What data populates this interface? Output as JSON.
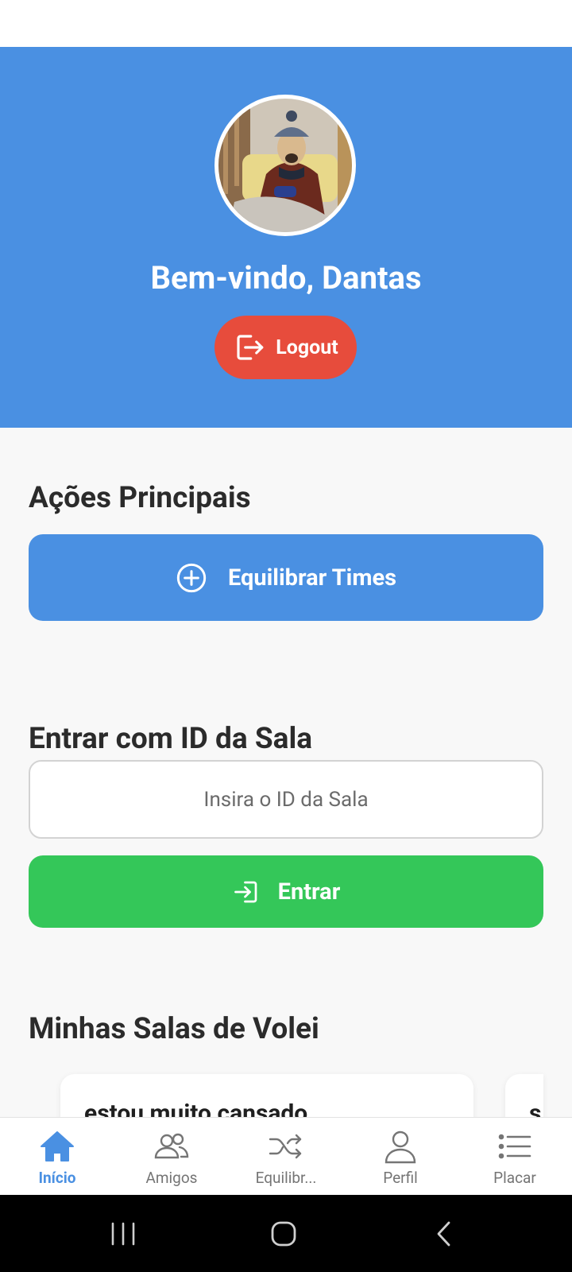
{
  "header": {
    "welcome_text": "Bem-vindo, Dantas",
    "avatar_icon": "user-avatar-photo",
    "logout_label": "Logout",
    "logout_icon": "logout-icon"
  },
  "main_actions": {
    "title": "Ações Principais",
    "balance_button_label": "Equilibrar Times",
    "balance_button_icon": "plus-circle-icon"
  },
  "join_room": {
    "title": "Entrar com ID da Sala",
    "input_value": "",
    "input_placeholder": "Insira o ID da Sala",
    "enter_button_label": "Entrar",
    "enter_button_icon": "enter-icon"
  },
  "my_rooms": {
    "title": "Minhas Salas de Volei",
    "rooms": [
      {
        "name": "estou muito cansado"
      },
      {
        "name": "s"
      }
    ]
  },
  "tabs": [
    {
      "label": "Início",
      "icon": "home-icon",
      "active": true
    },
    {
      "label": "Amigos",
      "icon": "friends-icon",
      "active": false
    },
    {
      "label": "Equilibr...",
      "icon": "shuffle-icon",
      "active": false
    },
    {
      "label": "Perfil",
      "icon": "profile-icon",
      "active": false
    },
    {
      "label": "Placar",
      "icon": "list-icon",
      "active": false
    }
  ],
  "colors": {
    "primary": "#4a90e2",
    "danger": "#e74c3c",
    "success": "#34c759",
    "background": "#f8f8f8"
  }
}
